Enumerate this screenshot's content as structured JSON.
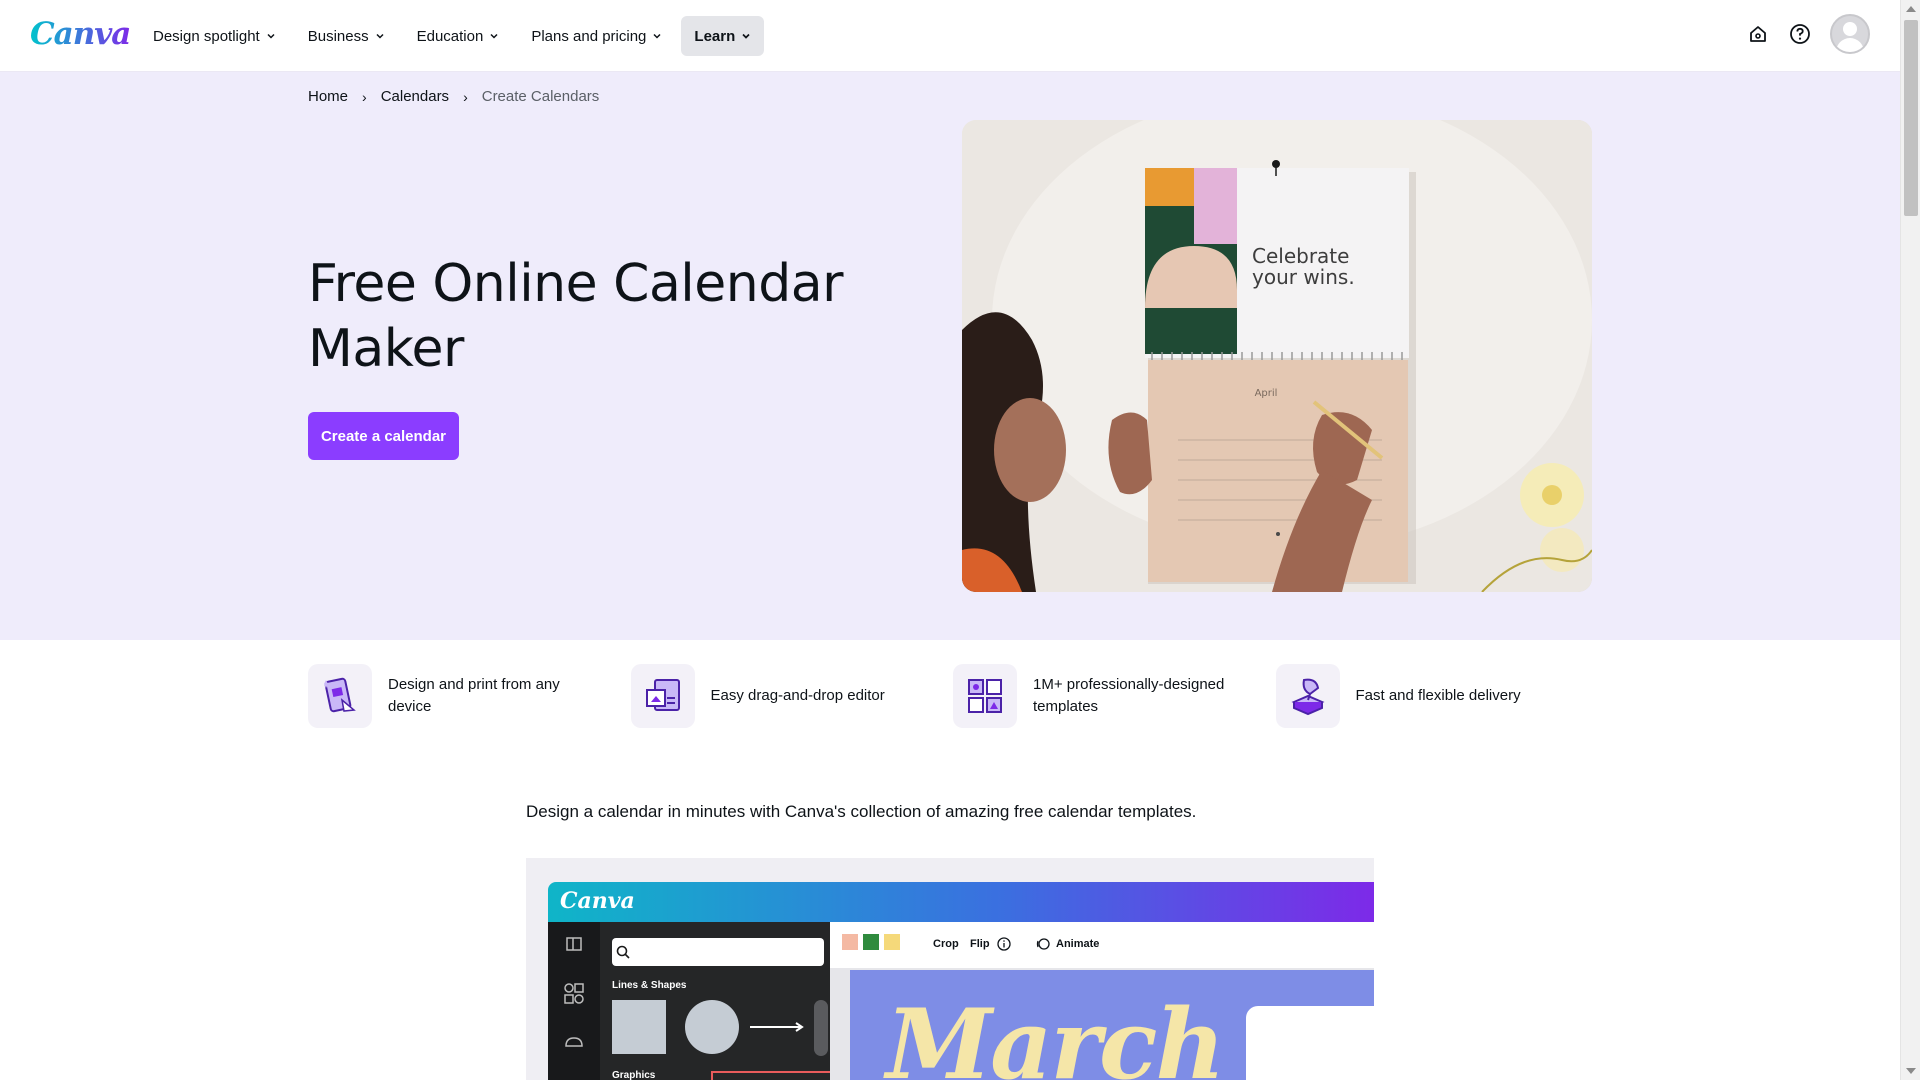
{
  "brand": {
    "logo": "Canva",
    "accent": "#8b3dff",
    "hero_bg": "#efecfb"
  },
  "nav": {
    "items": [
      {
        "label": "Design spotlight",
        "icon": "chevron-down-icon"
      },
      {
        "label": "Business",
        "icon": "chevron-down-icon"
      },
      {
        "label": "Education",
        "icon": "chevron-down-icon"
      },
      {
        "label": "Plans and pricing",
        "icon": "chevron-down-icon"
      },
      {
        "label": "Learn",
        "icon": "chevron-down-icon"
      }
    ],
    "right_icons": [
      "home-icon",
      "help-icon",
      "avatar"
    ]
  },
  "breadcrumb": [
    "Home",
    "Calendars",
    "Create Calendars"
  ],
  "hero": {
    "title": "Free Online Calendar Maker",
    "cta": "Create a calendar",
    "image": {
      "headline": "Celebrate your wins.",
      "month_label": "April"
    }
  },
  "features": [
    {
      "icon": "design-print-icon",
      "text": "Design and print from any device"
    },
    {
      "icon": "drag-drop-icon",
      "text": "Easy drag-and-drop editor"
    },
    {
      "icon": "templates-icon",
      "text": "1M+ professionally-designed templates"
    },
    {
      "icon": "delivery-icon",
      "text": "Fast and flexible delivery"
    }
  ],
  "intro": "Design a calendar in minutes with Canva's collection of amazing free calendar templates.",
  "preview": {
    "logo": "Canva",
    "panel_heading": "Lines & Shapes",
    "panel_heading_2": "Graphics",
    "toolbar": [
      "Crop",
      "Flip",
      "Animate"
    ],
    "swatches": [
      "#f4b9a3",
      "#2f8b3e",
      "#f5d97a"
    ],
    "canvas_word": "March"
  }
}
